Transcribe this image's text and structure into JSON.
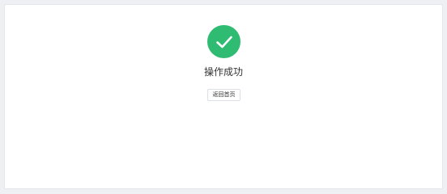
{
  "result": {
    "status_icon": "check-circle-icon",
    "title": "操作成功",
    "back_home_label": "返回首页"
  },
  "colors": {
    "success": "#2fbb72",
    "background": "#eef0f4",
    "panel": "#ffffff",
    "border": "#dcdfe6"
  }
}
